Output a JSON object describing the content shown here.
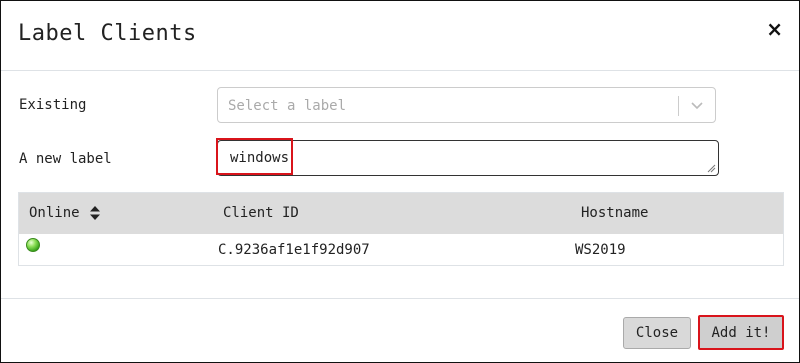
{
  "dialog": {
    "title": "Label Clients",
    "close_icon": "×"
  },
  "form": {
    "existing_label": "Existing",
    "select_placeholder": "Select a label",
    "new_label": "A new label",
    "new_label_value": "windows"
  },
  "table": {
    "headers": [
      "Online",
      "Client ID",
      "Hostname"
    ],
    "rows": [
      {
        "online": "online",
        "client_id": "C.9236af1e1f92d907",
        "hostname": "WS2019"
      }
    ]
  },
  "footer": {
    "close_label": "Close",
    "add_label": "Add it!"
  },
  "colors": {
    "highlight": "#d9141b",
    "status_online": "#3cb017"
  }
}
